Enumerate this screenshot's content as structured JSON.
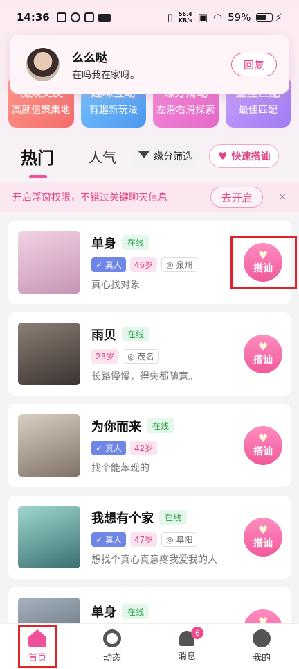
{
  "status_bar": {
    "time": "14:36",
    "net_speed": "56.4",
    "net_unit": "KB/s",
    "battery": "59%"
  },
  "notification": {
    "name": "么么哒",
    "message": "在吗我在家呀。",
    "reply_label": "回复"
  },
  "categories": [
    {
      "title": "视频交友",
      "subtitle": "高颜值聚集地"
    },
    {
      "title": "趣味互动",
      "subtitle": "有趣新玩法"
    },
    {
      "title": "缘分滑动",
      "subtitle": "左滑右滑探索"
    },
    {
      "title": "星座匹配",
      "subtitle": "最佳匹配"
    }
  ],
  "tabs": {
    "hot": "热门",
    "popular": "人气",
    "filter": "缘分筛选",
    "quick_chat": "快速搭讪"
  },
  "perm_bar": {
    "text": "开启浮窗权限，不错过关键聊天信息",
    "open_label": "去开启",
    "close_glyph": "×"
  },
  "users": [
    {
      "name": "单身",
      "online": "在线",
      "verified": "真人",
      "age": "46岁",
      "location": "泉州",
      "bio": "真心找对象",
      "action": "搭讪"
    },
    {
      "name": "雨贝",
      "online": "在线",
      "verified": "",
      "age": "23岁",
      "location": "茂名",
      "bio": "长路慢慢，得失都随意。",
      "action": "搭讪"
    },
    {
      "name": "为你而来",
      "online": "在线",
      "verified": "真人",
      "age": "42岁",
      "location": "",
      "bio": "找个能苯现的",
      "action": "搭讪"
    },
    {
      "name": "我想有个家",
      "online": "在线",
      "verified": "真人",
      "age": "47岁",
      "location": "阜阳",
      "bio": "想找个真心真意疼我爱我的人",
      "action": "搭讪"
    },
    {
      "name": "单身",
      "online": "在线",
      "verified": "",
      "age": "",
      "location": "",
      "bio": "",
      "action": "搭讪"
    }
  ],
  "bottom_nav": {
    "home": "首页",
    "feed": "动态",
    "messages": "消息",
    "messages_badge": "6",
    "me": "我的"
  },
  "colors": {
    "accent": "#f0509a",
    "online_green": "#27a04a",
    "highlight_red": "#e0222a"
  }
}
